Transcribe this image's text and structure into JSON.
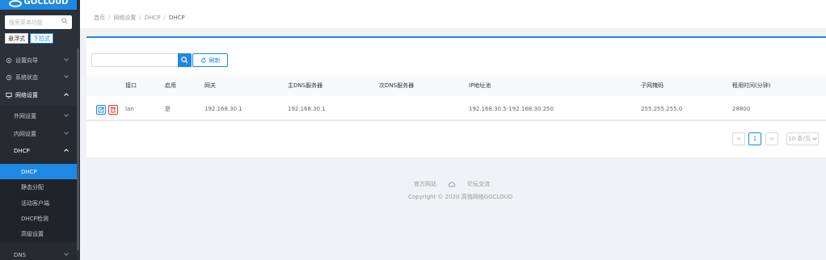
{
  "app": {
    "brand": "GOCLOUD"
  },
  "sidebar": {
    "search_placeholder": "搜索菜单功能",
    "modes": [
      "悬浮式",
      "下拉式"
    ],
    "items": [
      {
        "label": "设置向导"
      },
      {
        "label": "系统状态"
      },
      {
        "label": "网络设置"
      },
      {
        "label": "外网设置"
      },
      {
        "label": "内网设置"
      },
      {
        "label": "DHCP"
      },
      {
        "label": "DHCP"
      },
      {
        "label": "静态分配"
      },
      {
        "label": "活动客户端"
      },
      {
        "label": "DHCP检测"
      },
      {
        "label": "高级设置"
      },
      {
        "label": "DNS"
      }
    ]
  },
  "breadcrumb": {
    "items": [
      "首页",
      "网络设置",
      "DHCP",
      "DHCP"
    ],
    "sep": "/"
  },
  "toolbar": {
    "refresh_label": "刷新",
    "search_value": ""
  },
  "table": {
    "columns": [
      "接口",
      "启用",
      "网关",
      "主DNS服务器",
      "次DNS服务器",
      "IP地址池",
      "子网掩码",
      "租用时间(分钟)"
    ],
    "rows": [
      {
        "iface": "lan",
        "enabled": "是",
        "gateway": "192.168.30.1",
        "dns1": "192.168.30.1",
        "dns2": "",
        "pool": "192.168.30.5-192.168.30.250",
        "mask": "255.255.255.0",
        "lease": "28800"
      }
    ]
  },
  "pagination": {
    "prev": "<",
    "current": "1",
    "next": ">",
    "page_size": "10 条/页"
  },
  "footer": {
    "link1": "官方网站",
    "link2": "论坛交流",
    "copyright": "Copyright © 2020 高恪网络GOCLOUD"
  },
  "colors": {
    "accent": "#1e88e5",
    "danger": "#e53935",
    "sidebar_bg": "#2b3138"
  }
}
